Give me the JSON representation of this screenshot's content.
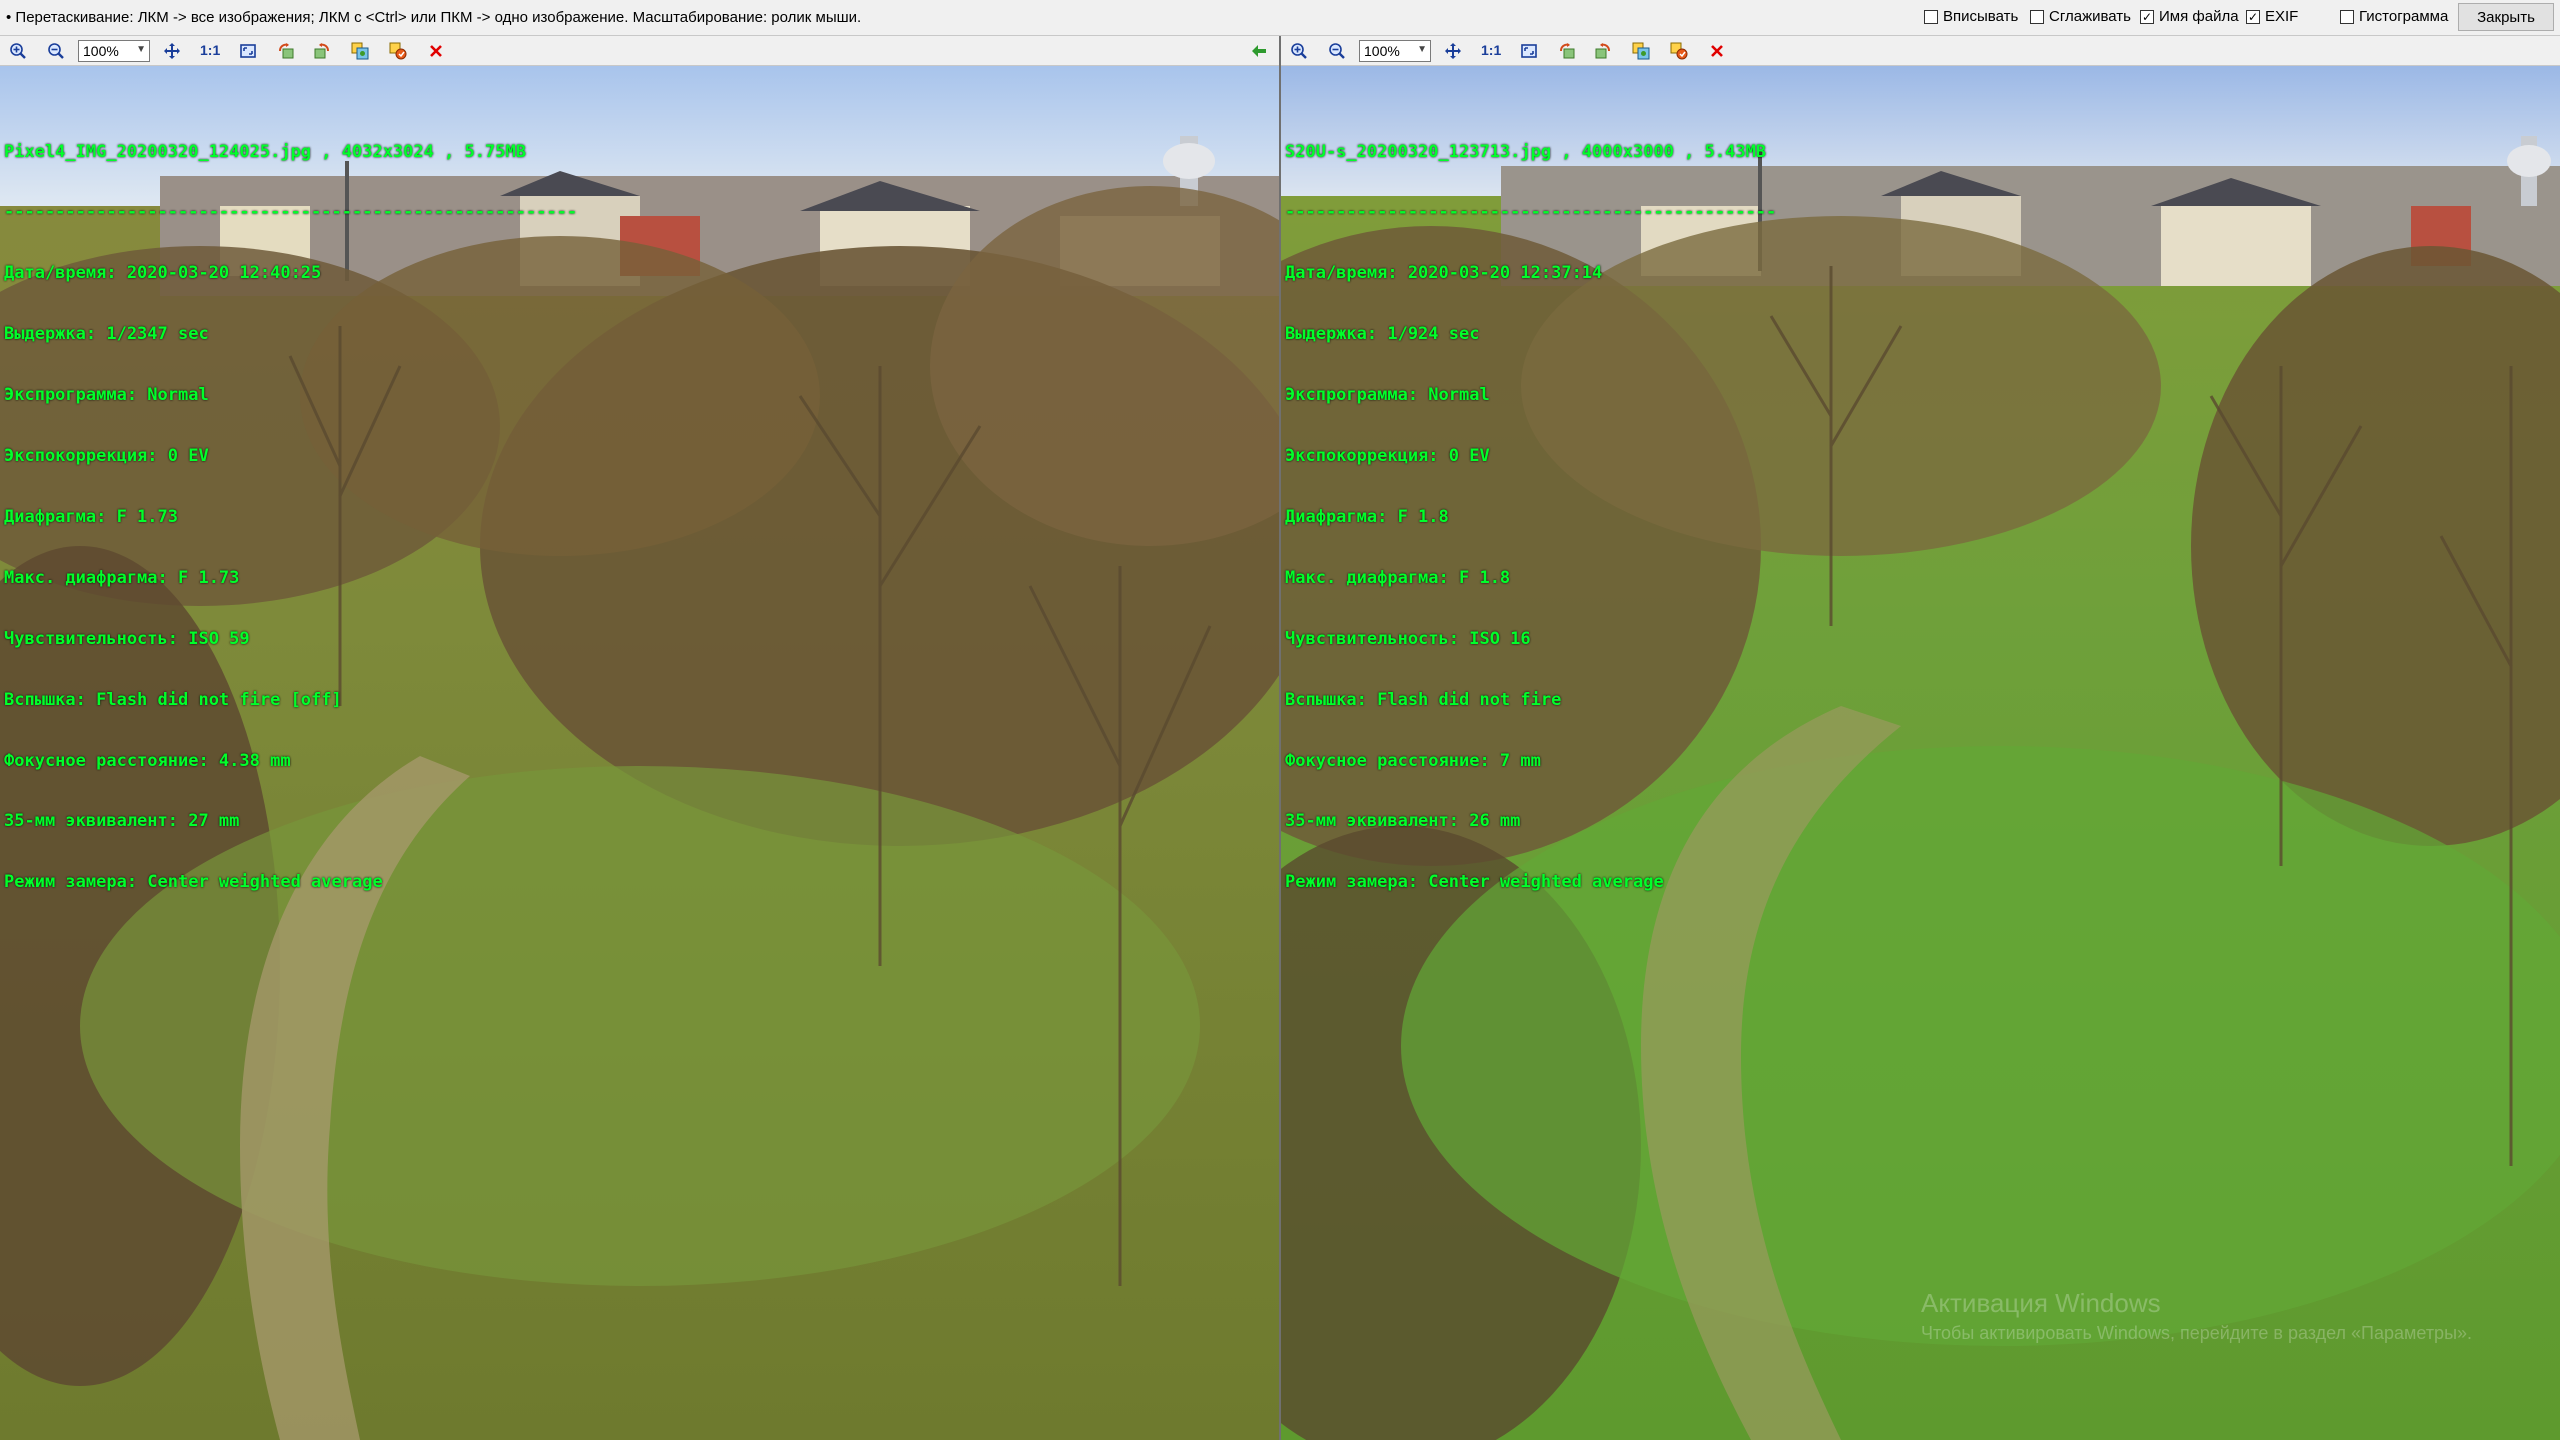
{
  "hint": "• Перетаскивание: ЛКМ -> все изображения; ЛКМ с <Ctrl> или ПКМ -> одно изображение. Масштабирование: ролик мыши.",
  "options": [
    {
      "label": "Вписывать",
      "checked": false
    },
    {
      "label": "Сглаживать",
      "checked": false
    },
    {
      "label": "Имя файла",
      "checked": true
    },
    {
      "label": "EXIF",
      "checked": true
    },
    {
      "label": "Гистограмма",
      "checked": false
    }
  ],
  "close_label": "Закрыть",
  "toolbar": {
    "zoom_value": "100%",
    "one_to_one": "1:1"
  },
  "icons": {
    "zoom_in": "zoom-in-icon",
    "zoom_out": "zoom-out-icon",
    "move": "move-arrows-icon",
    "fit": "fit-window-icon",
    "rotate_left": "rotate-left-icon",
    "rotate_right": "rotate-right-icon",
    "copy": "copy-image-icon",
    "save": "save-image-icon",
    "close": "close-red-x-icon",
    "sync": "sync-green-arrow-icon"
  },
  "colors": {
    "exif_text": "#00ff2a",
    "close_x": "#e00000",
    "accent_icon": "#1a3e9a"
  },
  "left": {
    "file_line": "Pixel4_IMG_20200320_124025.jpg , 4032x3024 , 5.75MB",
    "separator": "--------------------------------------------------------",
    "exif": [
      "Дата/время: 2020-03-20 12:40:25",
      "Выдержка: 1/2347 sec",
      "Экспрограмма: Normal",
      "Экспокоррекция: 0 EV",
      "Диафрагма: F 1.73",
      "Макс. диафрагма: F 1.73",
      "Чувствительность: ISO 59",
      "Вспышка: Flash did not fire [off]",
      "Фокусное расстояние: 4.38 mm",
      "35-мм эквивалент: 27 mm",
      "Режим замера: Center weighted average"
    ]
  },
  "right": {
    "file_line": "S20U-s_20200320_123713.jpg , 4000x3000 , 5.43MB",
    "separator": "------------------------------------------------",
    "exif": [
      "Дата/время: 2020-03-20 12:37:14",
      "Выдержка: 1/924 sec",
      "Экспрограмма: Normal",
      "Экспокоррекция: 0 EV",
      "Диафрагма: F 1.8",
      "Макс. диафрагма: F 1.8",
      "Чувствительность: ISO 16",
      "Вспышка: Flash did not fire",
      "Фокусное расстояние: 7 mm",
      "35-мм эквивалент: 26 mm",
      "Режим замера: Center weighted average"
    ],
    "watermark_title": "Активация Windows",
    "watermark_sub": "Чтобы активировать Windows, перейдите в раздел «Параметры»."
  }
}
